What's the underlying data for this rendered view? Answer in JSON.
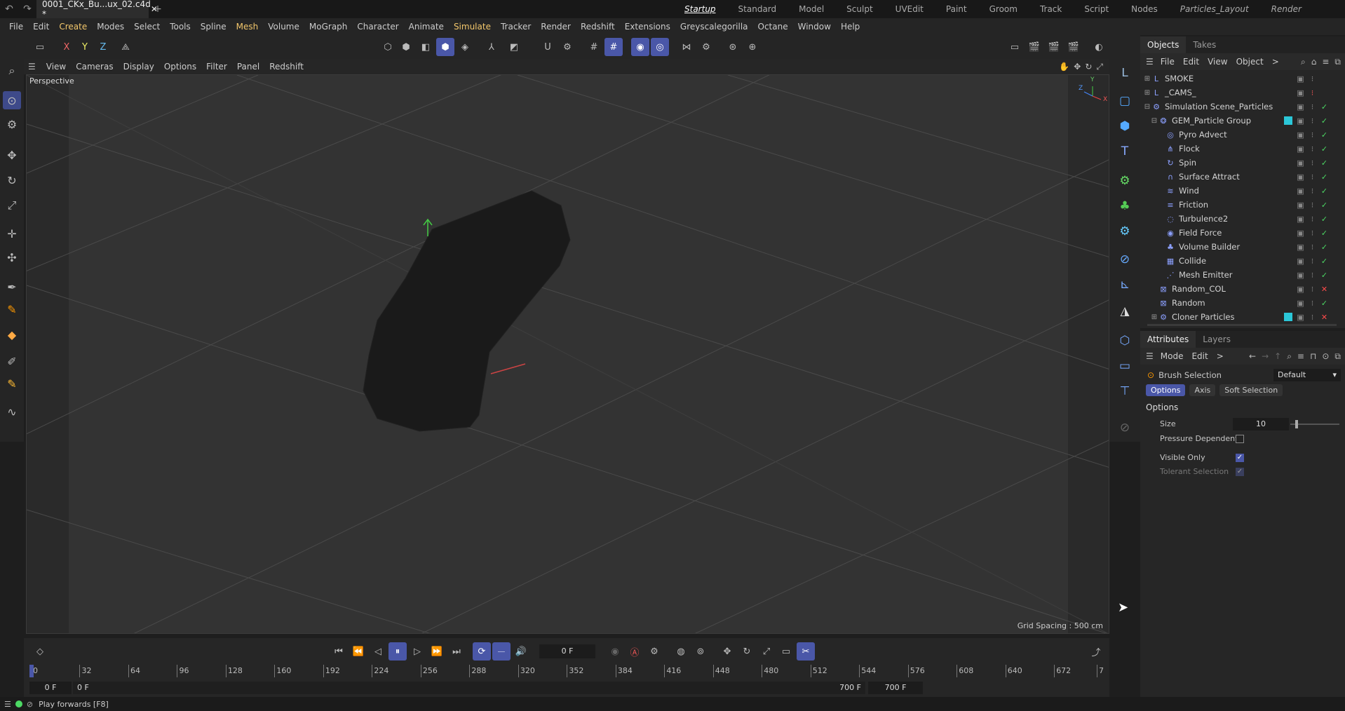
{
  "title_bar": {
    "document_tab": "0001_CKx_Bu...ux_02.c4d *",
    "layouts": [
      "Startup",
      "Standard",
      "Model",
      "Sculpt",
      "UVEdit",
      "Paint",
      "Groom",
      "Track",
      "Script",
      "Nodes",
      "Particles_Layout",
      "Render"
    ],
    "active_layout": "Startup"
  },
  "menu": [
    "File",
    "Edit",
    "Create",
    "Modes",
    "Select",
    "Tools",
    "Spline",
    "Mesh",
    "Volume",
    "MoGraph",
    "Character",
    "Animate",
    "Simulate",
    "Tracker",
    "Render",
    "Redshift",
    "Extensions",
    "Greyscalegorilla",
    "Octane",
    "Window",
    "Help"
  ],
  "highlighted_menus": [
    "Create",
    "Mesh",
    "Simulate"
  ],
  "axis_lock": {
    "x": "X",
    "y": "Y",
    "z": "Z"
  },
  "viewport": {
    "menu": [
      "View",
      "Cameras",
      "Display",
      "Options",
      "Filter",
      "Panel",
      "Redshift"
    ],
    "label": "Perspective",
    "grid_spacing": "Grid Spacing : 500 cm",
    "gizmo": {
      "y": "Y",
      "x": "X",
      "z": "Z"
    }
  },
  "objects_panel": {
    "tabs": [
      "Objects",
      "Takes"
    ],
    "menu": [
      "File",
      "Edit",
      "View",
      "Object"
    ],
    "more": ">",
    "items": [
      {
        "name": "SMOKE",
        "level": 0,
        "expander": "⊞",
        "icon": "L",
        "status": "dot"
      },
      {
        "name": "_CAMS_",
        "level": 0,
        "expander": "⊞",
        "icon": "L",
        "status": "dot-red"
      },
      {
        "name": "Simulation Scene_Particles",
        "level": 0,
        "expander": "⊟",
        "icon": "⚙",
        "status": "check"
      },
      {
        "name": "GEM_Particle Group",
        "level": 1,
        "expander": "⊟",
        "icon": "❂",
        "status": "check",
        "tag": true
      },
      {
        "name": "Pyro Advect",
        "level": 2,
        "expander": "",
        "icon": "◎",
        "status": "check"
      },
      {
        "name": "Flock",
        "level": 2,
        "expander": "",
        "icon": "⋔",
        "status": "check"
      },
      {
        "name": "Spin",
        "level": 2,
        "expander": "",
        "icon": "↻",
        "status": "check"
      },
      {
        "name": "Surface Attract",
        "level": 2,
        "expander": "",
        "icon": "∩",
        "status": "check"
      },
      {
        "name": "Wind",
        "level": 2,
        "expander": "",
        "icon": "≋",
        "status": "check"
      },
      {
        "name": "Friction",
        "level": 2,
        "expander": "",
        "icon": "≡",
        "status": "check"
      },
      {
        "name": "Turbulence2",
        "level": 2,
        "expander": "",
        "icon": "◌",
        "status": "check"
      },
      {
        "name": "Field Force",
        "level": 2,
        "expander": "",
        "icon": "◉",
        "status": "check"
      },
      {
        "name": "Volume Builder",
        "level": 2,
        "expander": "",
        "icon": "♣",
        "status": "check"
      },
      {
        "name": "Collide",
        "level": 2,
        "expander": "",
        "icon": "▦",
        "status": "check"
      },
      {
        "name": "Mesh Emitter",
        "level": 2,
        "expander": "",
        "icon": "⋰",
        "status": "check"
      },
      {
        "name": "Random_COL",
        "level": 1,
        "expander": "",
        "icon": "⊠",
        "status": "cross"
      },
      {
        "name": "Random",
        "level": 1,
        "expander": "",
        "icon": "⊠",
        "status": "check"
      },
      {
        "name": "Cloner Particles",
        "level": 1,
        "expander": "⊞",
        "icon": "⚙",
        "status": "cross",
        "tag": true
      }
    ]
  },
  "attributes_panel": {
    "tabs": [
      "Attributes",
      "Layers"
    ],
    "menu": [
      "Mode",
      "Edit"
    ],
    "more": ">",
    "tool_name": "Brush Selection",
    "preset": "Default",
    "subtabs": [
      "Options",
      "Axis",
      "Soft Selection"
    ],
    "active_subtab": "Options",
    "section": "Options",
    "size_label": "Size",
    "size_value": "10",
    "size_fraction": 0.1,
    "pressure_label": "Pressure Dependent",
    "pressure_checked": false,
    "visible_label": "Visible Only",
    "visible_checked": true,
    "tolerant_label": "Tolerant Selection",
    "tolerant_checked": true
  },
  "timeline": {
    "current_frame": "0 F",
    "ticks": [
      "0",
      "32",
      "64",
      "96",
      "128",
      "160",
      "192",
      "224",
      "256",
      "288",
      "320",
      "352",
      "384",
      "416",
      "448",
      "480",
      "512",
      "544",
      "576",
      "608",
      "640",
      "672",
      "7"
    ],
    "start_a": "0 F",
    "start_b": "0 F",
    "end_a": "700 F",
    "end_b": "700 F"
  },
  "status": {
    "message": "Play forwards [F8]"
  },
  "colors": {
    "accent": "#4a57a8",
    "check": "#4cd964",
    "cross": "#ff4b4b",
    "tag": "#2bc7d8",
    "menu_highlight": "#f3c76b"
  }
}
